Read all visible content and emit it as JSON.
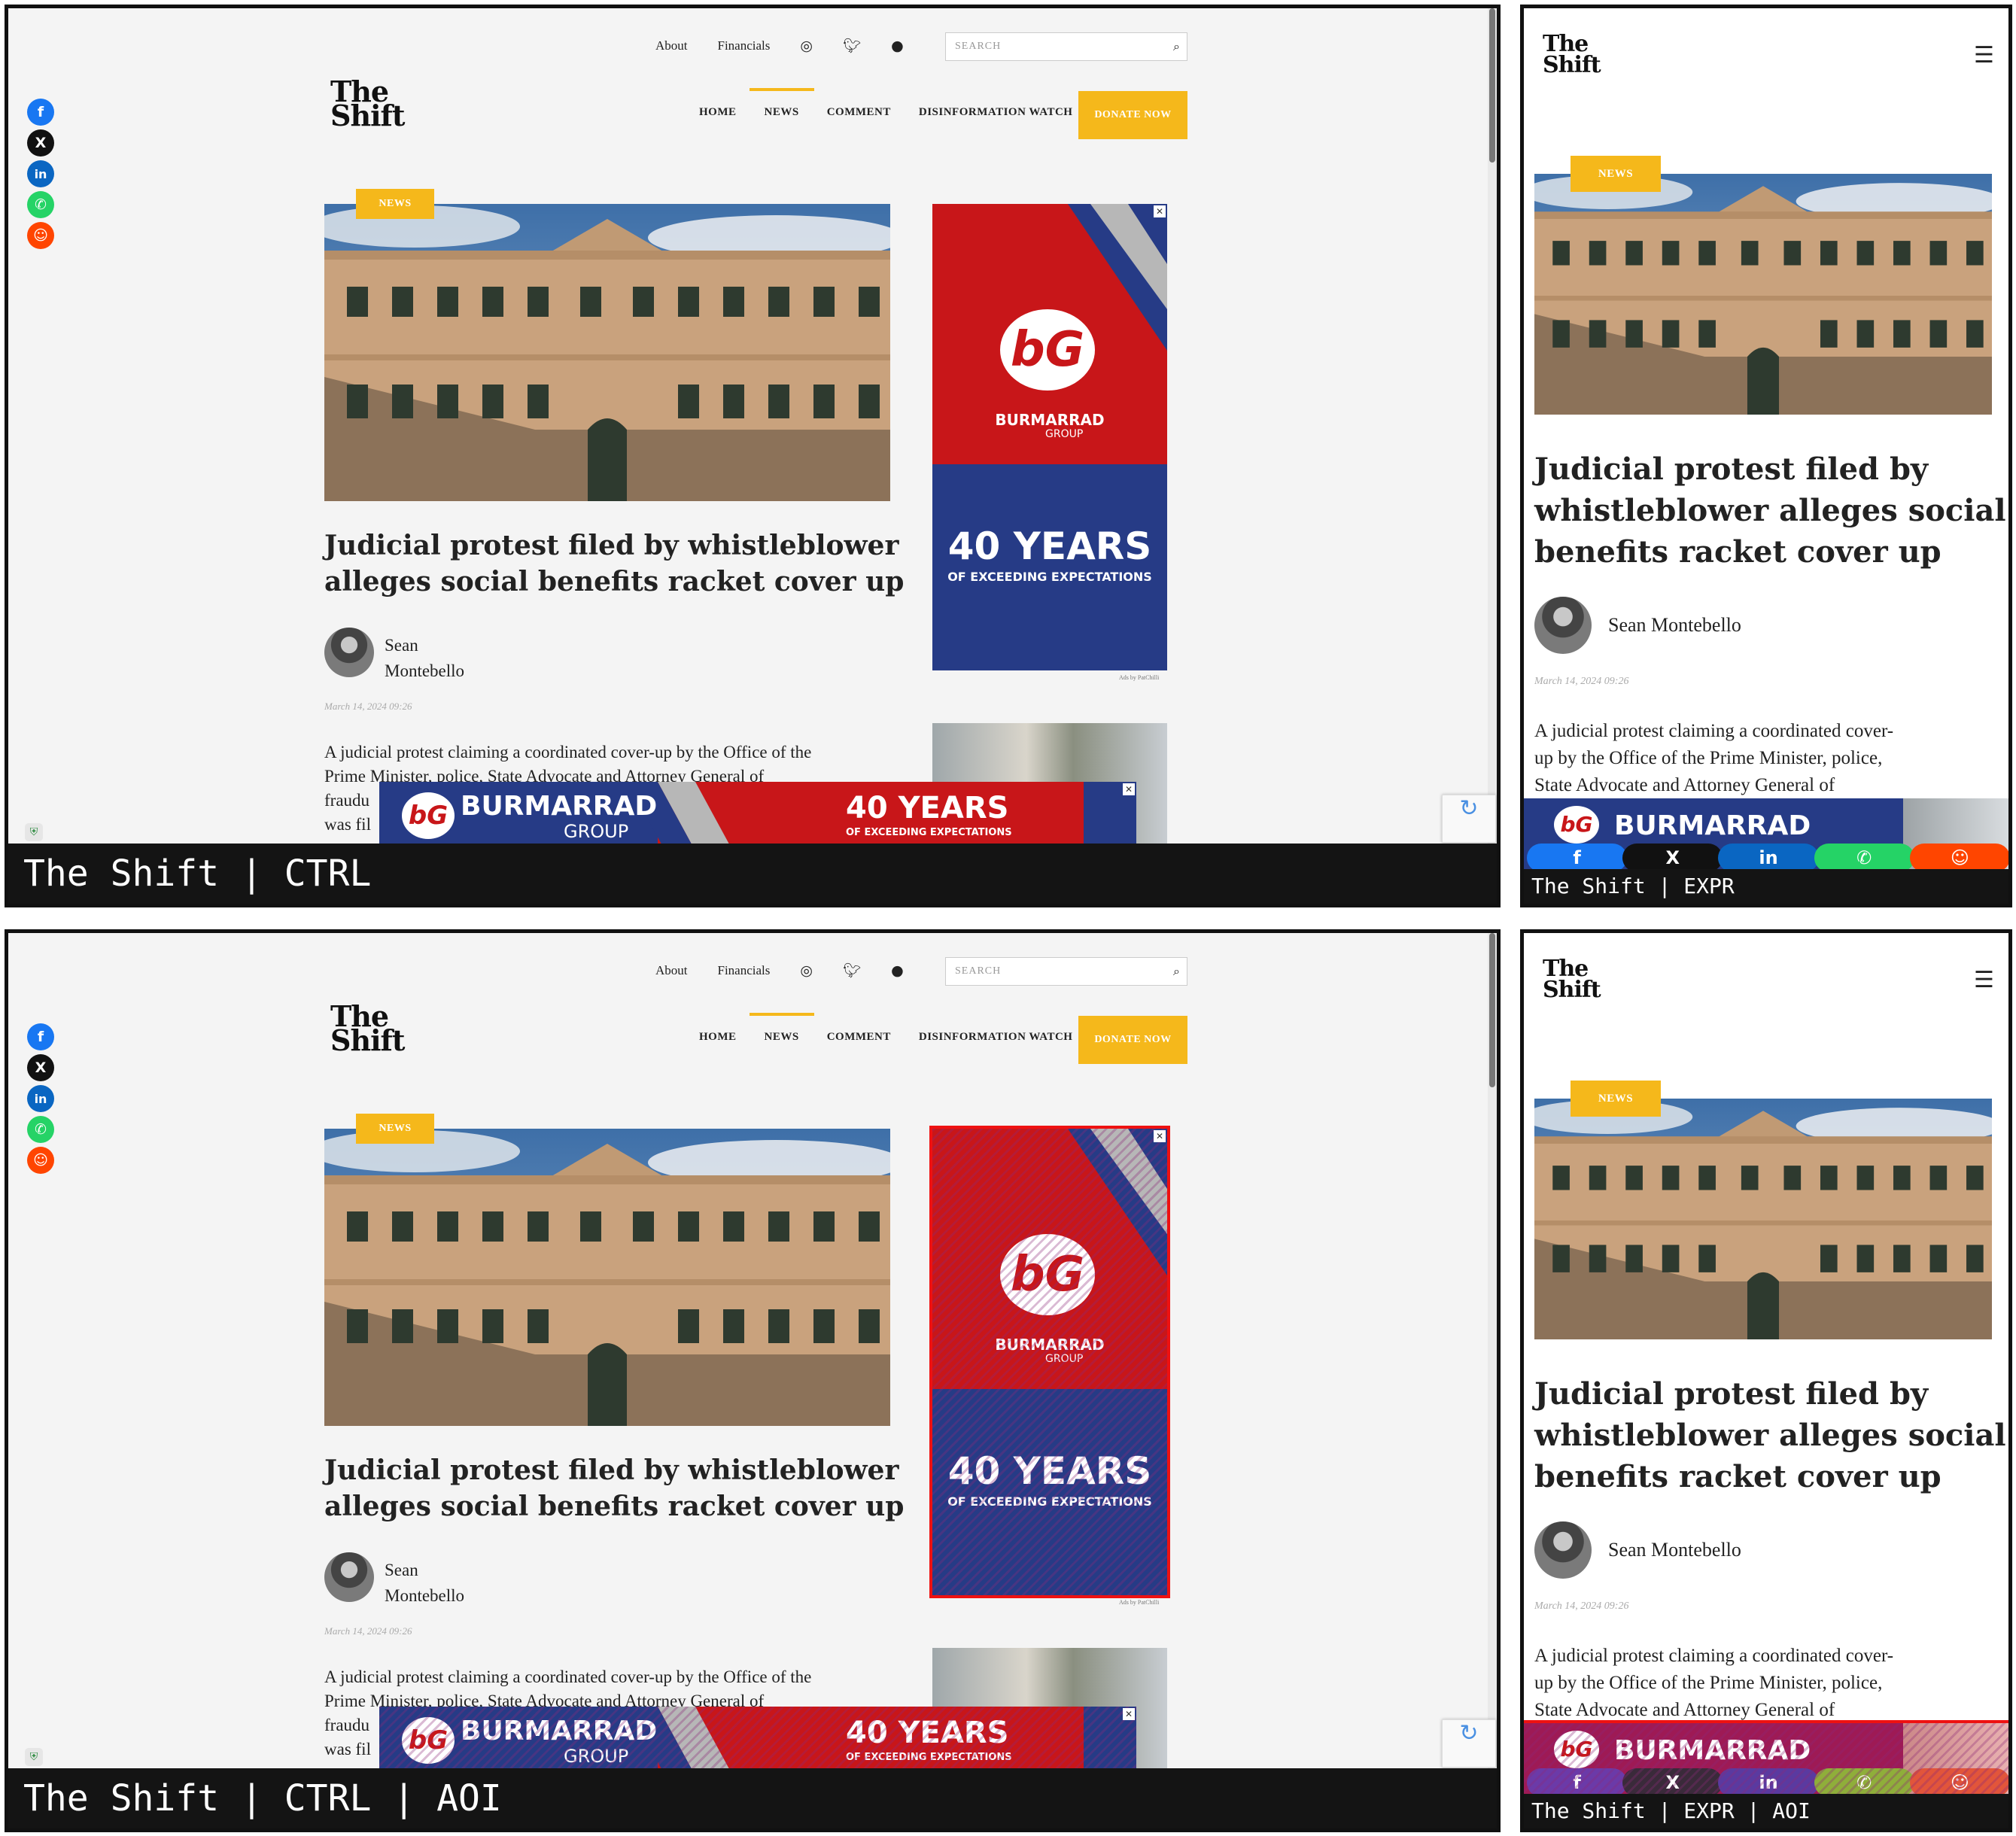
{
  "panels": [
    {
      "label": "The Shift | CTRL"
    },
    {
      "label": "The Shift | EXPR"
    },
    {
      "label": "The Shift | CTRL | AOI"
    },
    {
      "label": "The Shift | EXPR | AOI"
    }
  ],
  "site": {
    "logo_line1": "The",
    "logo_line2": "Shift",
    "top_links": [
      "About",
      "Financials"
    ],
    "search_placeholder": "SEARCH",
    "nav": [
      "HOME",
      "NEWS",
      "COMMENT",
      "DISINFORMATION WATCH"
    ],
    "active_nav": "NEWS",
    "donate": "DONATE NOW"
  },
  "article": {
    "category": "NEWS",
    "title_desktop_line1": "Judicial protest filed by whistleblower",
    "title_desktop_line2": "alleges social benefits racket cover up",
    "title_mobile_line1": "Judicial protest filed by",
    "title_mobile_line2": "whistleblower alleges social",
    "title_mobile_line3": "benefits racket cover up",
    "author_first": "Sean",
    "author_last": "Montebello",
    "author_full": "Sean Montebello",
    "date": "March 14, 2024 09:26",
    "body_desktop_line1": "A judicial protest claiming a coordinated cover-up by the Office of the",
    "body_desktop_line2": "Prime Minister, police, State Advocate and Attorney General of",
    "body_desktop_line3": "fraudu",
    "body_desktop_line4": "was fil",
    "body_mobile_line1": "A judicial protest claiming a coordinated cover-",
    "body_mobile_line2": "up by the Office of the Prime Minister, police,",
    "body_mobile_line3": "State Advocate and Attorney General of"
  },
  "ad": {
    "logo": "bG",
    "brand": "BURMARRAD",
    "group": "GROUP",
    "years": "40 YEARS",
    "tagline": "OF EXCEEDING EXPECTATIONS",
    "credit": "Ads by PatChilli"
  },
  "share_icons": [
    "facebook-icon",
    "x-icon",
    "linkedin-icon",
    "whatsapp-icon",
    "reddit-icon"
  ],
  "colors": {
    "accent": "#f5b81b",
    "ad_red": "#c81619",
    "ad_blue": "#263b86",
    "aoi_outline": "#e11111",
    "facebook": "#1877f2",
    "x": "#111111",
    "linkedin": "#0a66c2",
    "whatsapp": "#25d366",
    "reddit": "#ff4500"
  }
}
